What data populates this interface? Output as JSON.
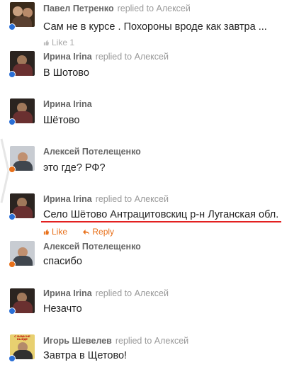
{
  "colors": {
    "dot_blue": "#2a6fd6",
    "dot_orange": "#e8701a",
    "action_orange": "#e8701a",
    "highlight_underline": "#e32020"
  },
  "comments": [
    {
      "author": "Павел Петренко",
      "replied": "replied to Алексей",
      "text": "Сам не в курсе . Похороны вроде как завтра ...",
      "like": "Like 1"
    },
    {
      "author": "Ирина Irina",
      "replied": "replied to Алексей",
      "text": "В Шотово"
    },
    {
      "author": "Ирина Irina",
      "replied": "",
      "text": "Шётово"
    },
    {
      "author": "Алексей Потелещенко",
      "replied": "",
      "text": "это где? РФ?"
    },
    {
      "author": "Ирина Irina",
      "replied": "replied to Алексей",
      "text": "Село Шётово Антрацитовскиц р-н Луганская обл.",
      "like": "Like",
      "reply": "Reply"
    },
    {
      "author": "Алексей Потелещенко",
      "replied": "",
      "text": "спасибо"
    },
    {
      "author": "Ирина Irina",
      "replied": "replied to Алексей",
      "text": "Незачто"
    },
    {
      "author": "Игорь Шевелев",
      "replied": "replied to Алексей",
      "text": "Завтра в Щетово!",
      "avatar_text": "С ВАМИ НЕ ВЫЙДЕ"
    }
  ]
}
